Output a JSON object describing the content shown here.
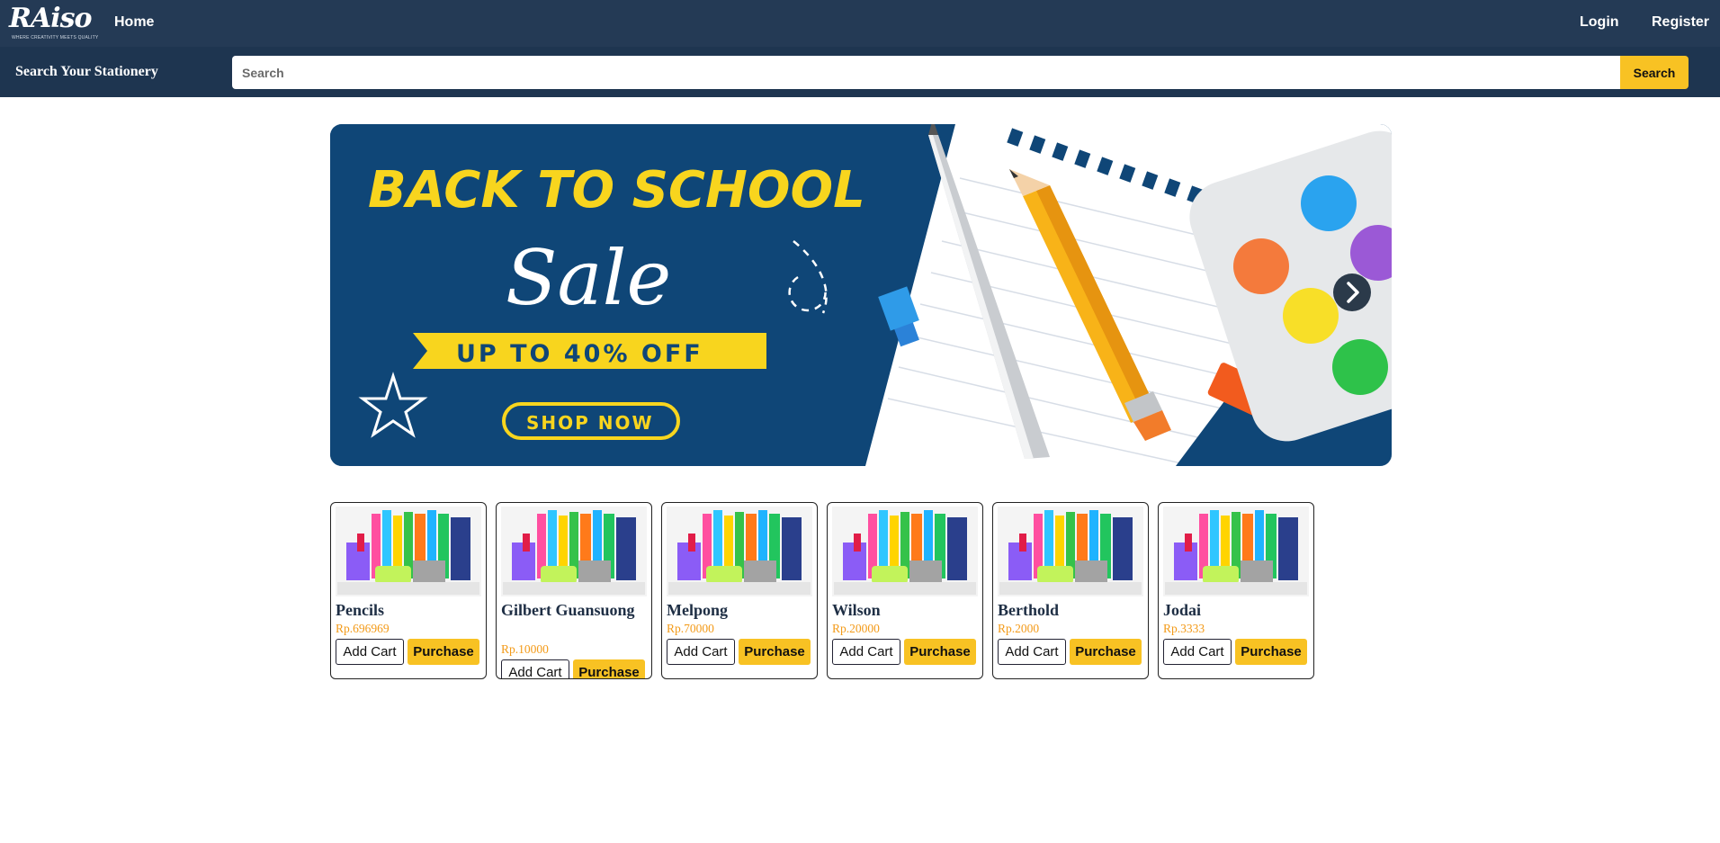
{
  "nav": {
    "logo_text": "RAiso",
    "logo_tagline": "WHERE CREATIVITY MEETS QUALITY",
    "home_label": "Home",
    "login_label": "Login",
    "register_label": "Register"
  },
  "search": {
    "label": "Search Your Stationery",
    "placeholder": "Search",
    "button_label": "Search"
  },
  "banner": {
    "headline": "BACK TO SCHOOL",
    "script": "Sale",
    "ribbon": "UP TO 40% OFF",
    "cta": "SHOP NOW"
  },
  "products": [
    {
      "name": "Pencils",
      "price": "Rp.696969",
      "add_cart_label": "Add Cart",
      "purchase_label": "Purchase"
    },
    {
      "name": "Gilbert Guansuong",
      "price": "Rp.10000",
      "add_cart_label": "Add Cart",
      "purchase_label": "Purchase"
    },
    {
      "name": "Melpong",
      "price": "Rp.70000",
      "add_cart_label": "Add Cart",
      "purchase_label": "Purchase"
    },
    {
      "name": "Wilson",
      "price": "Rp.20000",
      "add_cart_label": "Add Cart",
      "purchase_label": "Purchase"
    },
    {
      "name": "Berthold",
      "price": "Rp.2000",
      "add_cart_label": "Add Cart",
      "purchase_label": "Purchase"
    },
    {
      "name": "Jodai",
      "price": "Rp.3333",
      "add_cart_label": "Add Cart",
      "purchase_label": "Purchase"
    }
  ],
  "colors": {
    "nav_bg": "#243a55",
    "search_bar_bg": "#1e3550",
    "accent": "#f8c223",
    "price": "#f39a18",
    "banner_bg": "#0f4677"
  },
  "icons": {
    "banner_next": "chevron-right-icon",
    "product_image": "stationery-set-image"
  }
}
